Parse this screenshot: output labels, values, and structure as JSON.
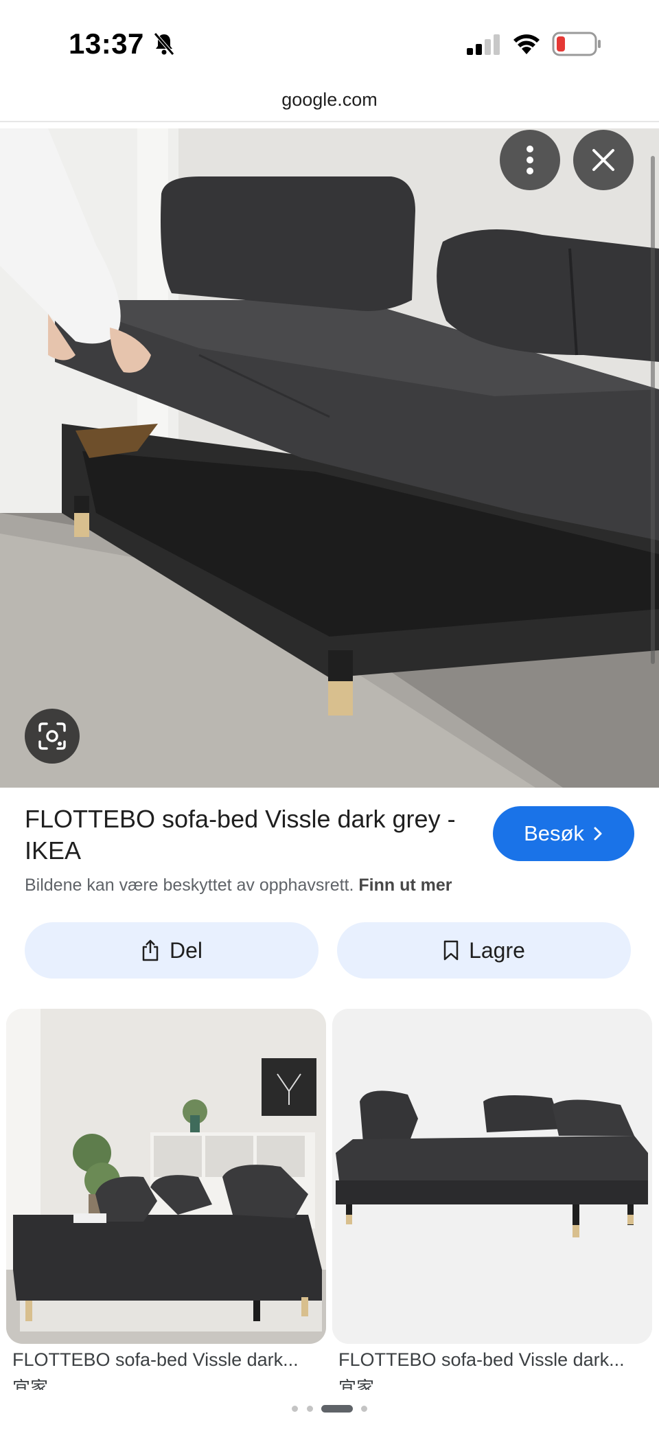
{
  "status_bar": {
    "time": "13:37",
    "icons": [
      "bell-slash-icon",
      "signal-icon",
      "wifi-icon",
      "battery-low-icon"
    ],
    "battery_color": "#e53935"
  },
  "browser": {
    "url": "google.com"
  },
  "viewer": {
    "buttons": [
      "more-options-icon",
      "close-icon",
      "lens-icon"
    ],
    "title": "FLOTTEBO sofa-bed Vissle dark grey - IKEA",
    "visit_label": "Besøk",
    "copyright_text": "Bildene kan være beskyttet av opphavsrett.",
    "learn_more_label": "Finn ut mer",
    "share_label": "Del",
    "save_label": "Lagre",
    "accent_color": "#1a73e8"
  },
  "related": [
    {
      "caption": "FLOTTEBO sofa-bed Vissle dark...",
      "source": "宜家"
    },
    {
      "caption": "FLOTTEBO sofa-bed Vissle dark...",
      "source": "宜家"
    }
  ],
  "pager": {
    "total": 4,
    "active": 3
  }
}
